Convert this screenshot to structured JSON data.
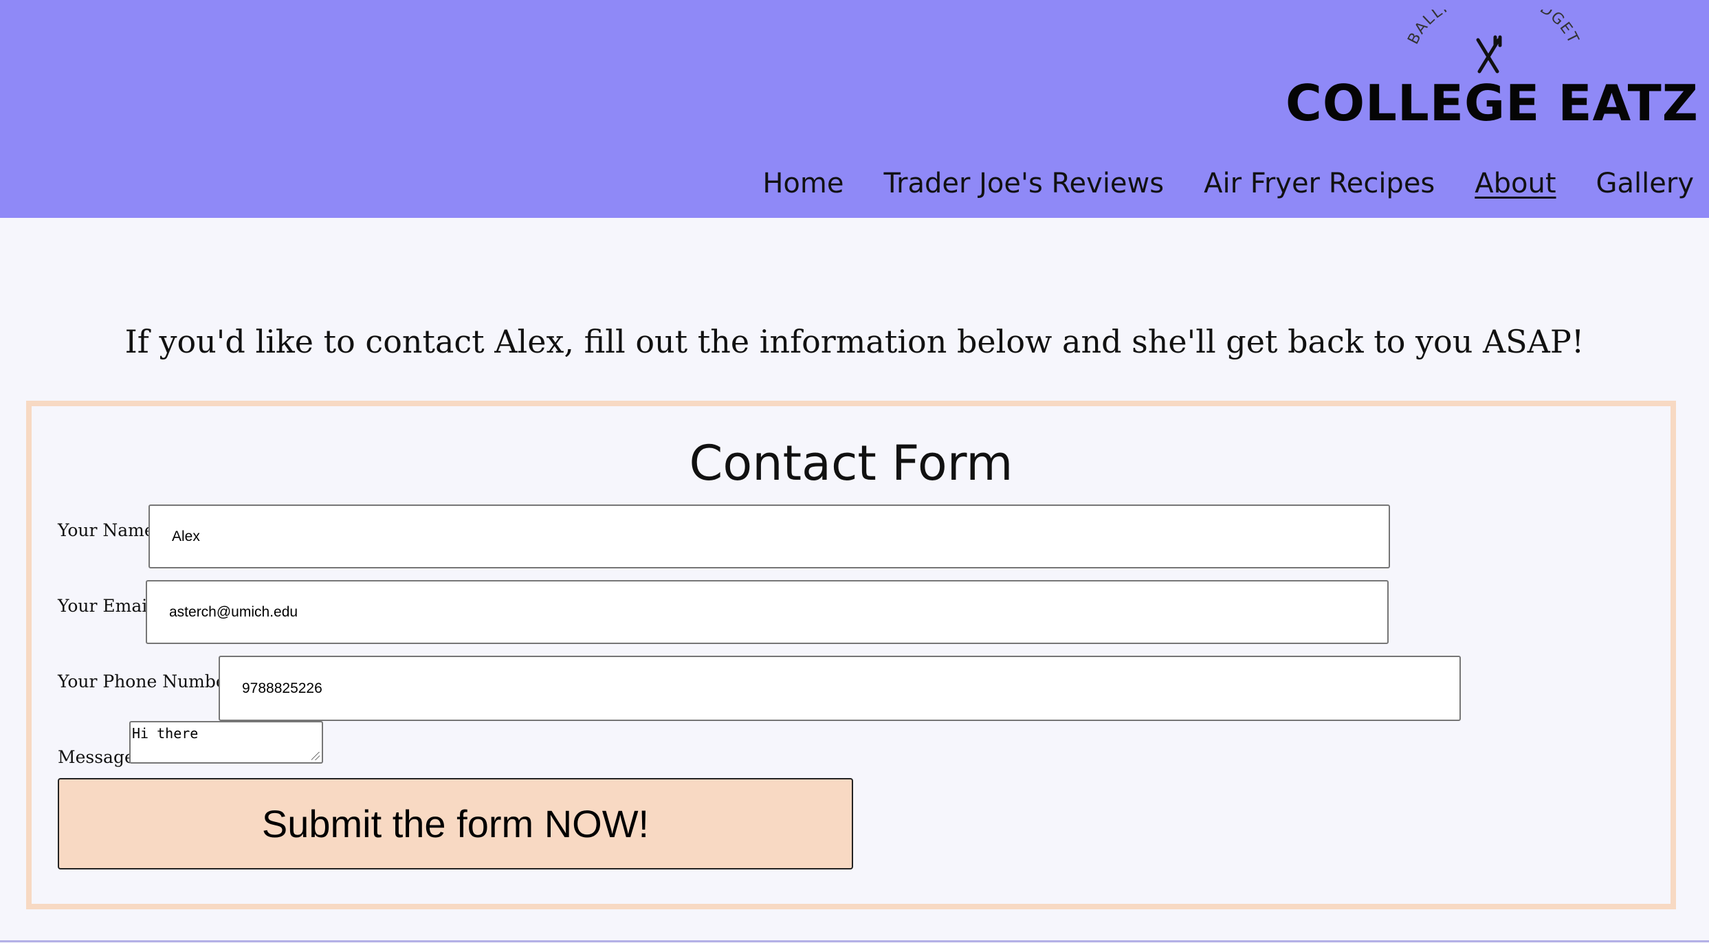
{
  "brand": {
    "tagline": "BALLIN ON A BUDGET",
    "title": "COLLEGE EATZ"
  },
  "nav": [
    {
      "label": "Home",
      "active": false
    },
    {
      "label": "Trader Joe's Reviews",
      "active": false
    },
    {
      "label": "Air Fryer Recipes",
      "active": false
    },
    {
      "label": "About",
      "active": true
    },
    {
      "label": "Gallery",
      "active": false
    }
  ],
  "intro": "If you'd like to contact Alex, fill out the information below and she'll get back to you ASAP!",
  "form": {
    "title": "Contact Form",
    "name_label": "Your Name",
    "name_value": "Alex",
    "email_label": "Your Email",
    "email_value": "asterch@umich.edu",
    "phone_label": "Your Phone Number",
    "phone_value": "9788825226",
    "message_label": "Message",
    "message_value": "Hi there",
    "submit_label": "Submit the form NOW!"
  },
  "colors": {
    "header_bg": "#8f89f7",
    "page_bg": "#f6f6fc",
    "accent_peach": "#f8d9c3"
  }
}
